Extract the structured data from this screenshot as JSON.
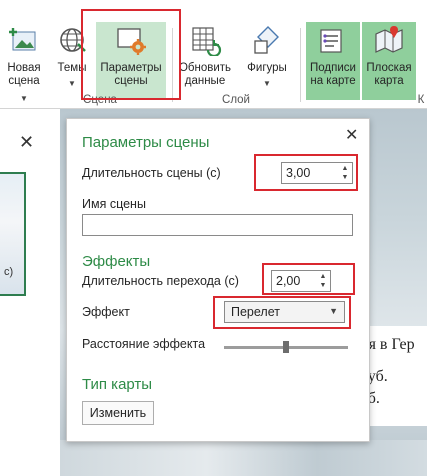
{
  "ribbon": {
    "buttons": [
      {
        "name": "new-scene-button",
        "label": "Новая\nсцена",
        "icon": "new-scene-icon"
      },
      {
        "name": "themes-button",
        "label": "Темы",
        "icon": "globe-icon"
      },
      {
        "name": "scene-parameters-button",
        "label": "Параметры\nсцены",
        "icon": "scene-settings-icon"
      },
      {
        "name": "refresh-data-button",
        "label": "Обновить\nданные",
        "icon": "refresh-table-icon"
      },
      {
        "name": "shapes-button",
        "label": "Фигуры",
        "icon": "shapes-icon"
      },
      {
        "name": "map-labels-button",
        "label": "Подписи\nна карте",
        "icon": "map-labels-icon"
      },
      {
        "name": "flat-map-button",
        "label": "Плоская\nкарта",
        "icon": "flat-map-icon"
      }
    ],
    "groups": {
      "scene": "Сцена",
      "layer": "Слой",
      "truncated": "К"
    }
  },
  "left_pane": {
    "close": "✕",
    "thumb_label": "с)"
  },
  "dialog": {
    "title": "Параметры сцены",
    "close": "✕",
    "duration_label": "Длительность сцены (с)",
    "duration_value": "3,00",
    "name_label": "Имя сцены",
    "name_value": "",
    "effects_title": "Эффекты",
    "transition_label": "Длительность перехода (с)",
    "transition_value": "2,00",
    "effect_label": "Эффект",
    "effect_value": "Перелет",
    "distance_label": "Расстояние эффекта",
    "distance_level": 0.5,
    "map_type_title": "Тип карты",
    "change_button": "Изменить"
  },
  "map_text": {
    "line1": "ия в Гер",
    "line2": "руб.",
    "line3": "уб."
  },
  "colors": {
    "accent_green": "#2e8b47",
    "highlight_red": "#d9282f",
    "ribbon_active": "#c9e6cf"
  }
}
